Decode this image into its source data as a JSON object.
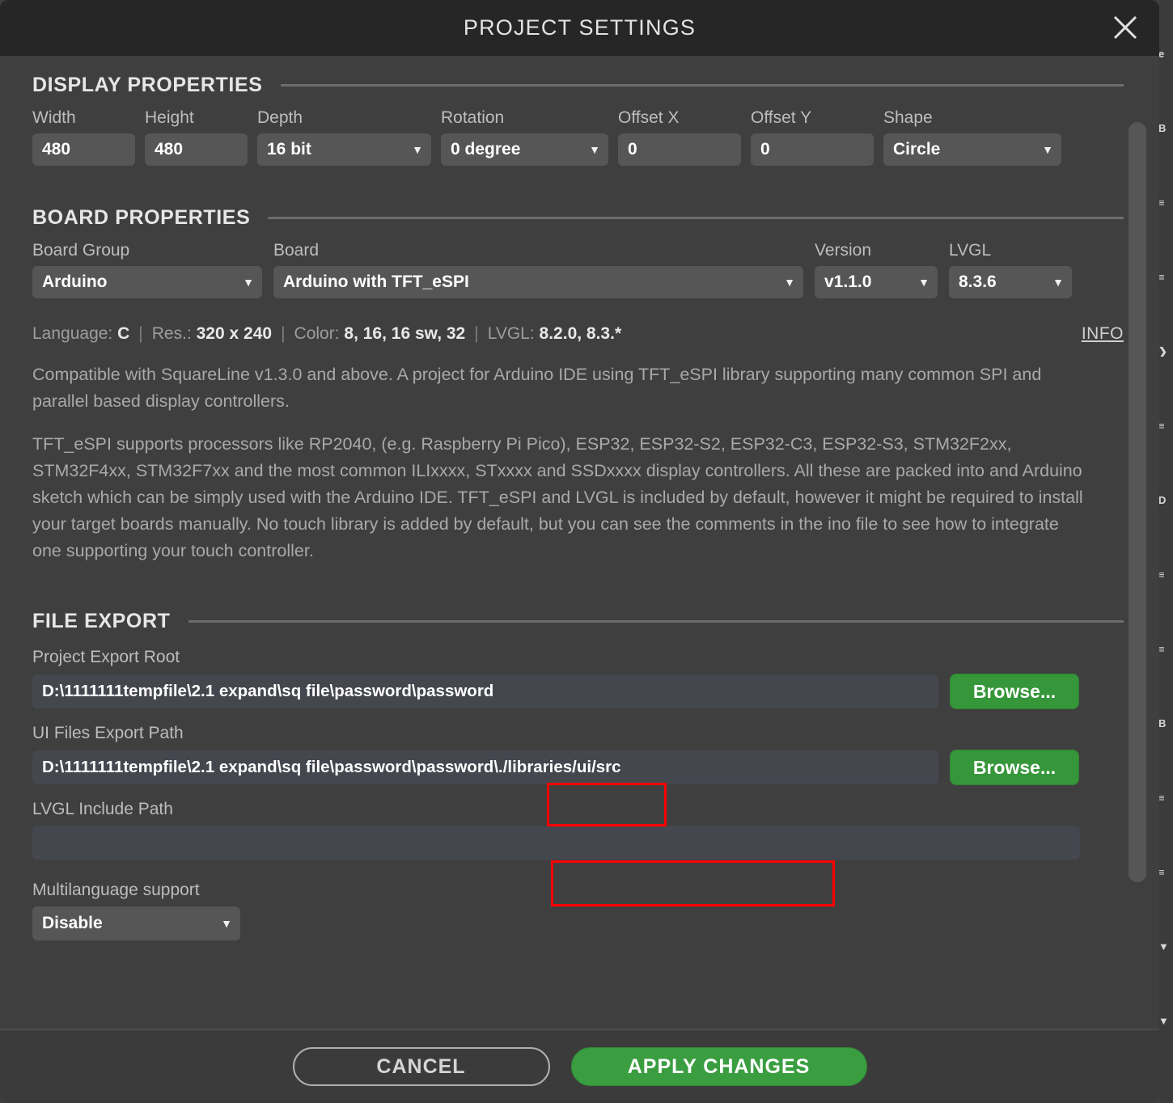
{
  "window": {
    "title": "PROJECT SETTINGS",
    "close_icon": "close-icon"
  },
  "display_properties": {
    "section_title": "DISPLAY PROPERTIES",
    "fields": [
      {
        "label": "Width",
        "value": "480",
        "type": "text"
      },
      {
        "label": "Height",
        "value": "480",
        "type": "text"
      },
      {
        "label": "Depth",
        "value": "16 bit",
        "type": "select"
      },
      {
        "label": "Rotation",
        "value": "0 degree",
        "type": "select"
      },
      {
        "label": "Offset X",
        "value": "0",
        "type": "text"
      },
      {
        "label": "Offset Y",
        "value": "0",
        "type": "text"
      },
      {
        "label": "Shape",
        "value": "Circle",
        "type": "select"
      }
    ]
  },
  "board_properties": {
    "section_title": "BOARD PROPERTIES",
    "fields": [
      {
        "label": "Board Group",
        "value": "Arduino"
      },
      {
        "label": "Board",
        "value": "Arduino with TFT_eSPI"
      },
      {
        "label": "Version",
        "value": "v1.1.0"
      },
      {
        "label": "LVGL",
        "value": "8.3.6"
      }
    ],
    "meta": {
      "language_key": "Language:",
      "language_value": "C",
      "res_key": "Res.:",
      "res_value": "320 x 240",
      "color_key": "Color:",
      "color_value": "8, 16, 16 sw, 32",
      "lvgl_key": "LVGL:",
      "lvgl_value": "8.2.0, 8.3.*",
      "separator": "|"
    },
    "info_label": "INFO",
    "description": [
      "Compatible with SquareLine v1.3.0 and above. A project for Arduino IDE using TFT_eSPI library supporting many common SPI and parallel based display controllers.",
      "TFT_eSPI supports processors like RP2040, (e.g. Raspberry Pi Pico), ESP32, ESP32-S2, ESP32-C3, ESP32-S3, STM32F2xx, STM32F4xx, STM32F7xx and the most common ILIxxxx, STxxxx and SSDxxxx display controllers. All these are packed into and Arduino sketch which can be simply used with the Arduino IDE. TFT_eSPI and LVGL is included by default, however it might be required to install your target boards manually.  No touch library is added by default, but you can see the comments in the ino file to see how to integrate one supporting your touch controller."
    ]
  },
  "file_export": {
    "section_title": "FILE EXPORT",
    "project_export_root": {
      "label": "Project Export Root",
      "value": "D:\\1111111tempfile\\2.1 expand\\sq file\\password\\password",
      "browse_label": "Browse..."
    },
    "ui_files_export_path": {
      "label": "UI Files Export Path",
      "value": "D:\\1111111tempfile\\2.1 expand\\sq file\\password\\password\\./libraries/ui/src",
      "browse_label": "Browse..."
    },
    "lvgl_include_path": {
      "label": "LVGL Include Path",
      "value": "",
      "placeholder": ""
    },
    "multilanguage_support": {
      "label": "Multilanguage support",
      "value": "Disable"
    }
  },
  "footer": {
    "cancel_label": "CANCEL",
    "apply_label": "APPLY CHANGES"
  },
  "colors": {
    "dialog_bg": "#3f3f3f",
    "titlebar_bg": "#262626",
    "control_bg": "#565656",
    "path_input_bg": "#45474f",
    "accent_green": "#36963a",
    "annotation_red": "#ff0000",
    "left_marker_blue": "#3b7dd8"
  },
  "background_app": {
    "edge_glyphs": [
      "e",
      "B",
      "≡",
      "≡",
      "❯",
      "≡",
      "D",
      "≡",
      "≡",
      "B",
      "≡",
      "≡",
      "▼",
      "▼"
    ]
  }
}
